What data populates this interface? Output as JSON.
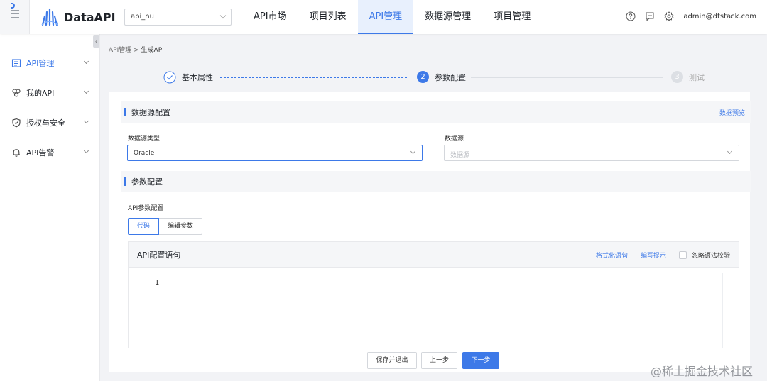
{
  "app": {
    "name": "DataAPI",
    "project": "api_nu"
  },
  "nav": {
    "tabs": [
      "API市场",
      "项目列表",
      "API管理",
      "数据源管理",
      "项目管理"
    ],
    "active": "API管理"
  },
  "topbar": {
    "user": "admin@dtstack.com",
    "icons": [
      "help-icon",
      "message-icon",
      "settings-icon"
    ]
  },
  "sidebar": {
    "items": [
      {
        "label": "API管理",
        "icon": "api-manage-icon",
        "active": true
      },
      {
        "label": "我的API",
        "icon": "my-api-icon",
        "active": false
      },
      {
        "label": "授权与安全",
        "icon": "shield-icon",
        "active": false
      },
      {
        "label": "API告警",
        "icon": "bell-icon",
        "active": false
      }
    ]
  },
  "breadcrumb": {
    "parent": "API管理",
    "sep": ">",
    "current": "生成API"
  },
  "steps": [
    {
      "num": "",
      "label": "基本属性",
      "state": "done"
    },
    {
      "num": "2",
      "label": "参数配置",
      "state": "current"
    },
    {
      "num": "3",
      "label": "测试",
      "state": "pending"
    }
  ],
  "datasource_section": {
    "title": "数据源配置",
    "preview_link": "数据预览"
  },
  "datasource_type": {
    "label": "数据源类型",
    "value": "Oracle"
  },
  "datasource": {
    "label": "数据源",
    "placeholder": "数据源"
  },
  "param_section": {
    "title": "参数配置"
  },
  "api_param": {
    "label": "API参数配置",
    "modes": [
      "代码",
      "编辑参数"
    ],
    "active_mode": "代码"
  },
  "editor": {
    "title": "API配置语句",
    "format_link": "格式化语句",
    "hint_link": "编写提示",
    "ignore_check_label": "忽略语法校验",
    "line_number": "1"
  },
  "footer": {
    "save_exit": "保存并退出",
    "prev": "上一步",
    "next": "下一步"
  },
  "watermark": "@稀土掘金技术社区",
  "colors": {
    "accent": "#3d79e8",
    "background": "#f2f3f6"
  }
}
